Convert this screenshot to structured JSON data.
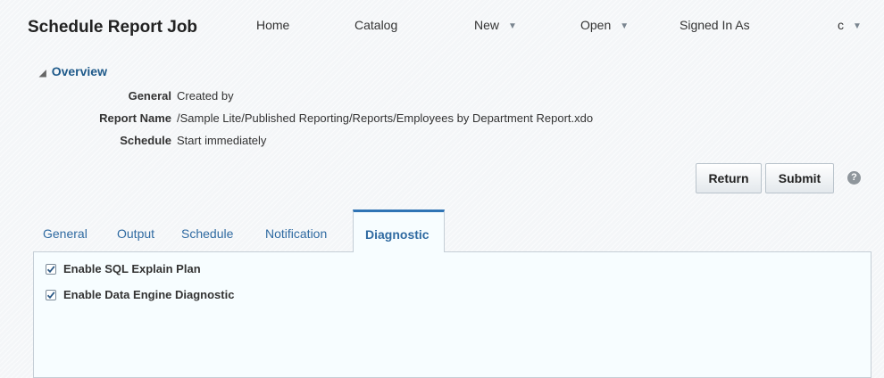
{
  "header": {
    "title": "Schedule Report Job",
    "nav": {
      "home": "Home",
      "catalog": "Catalog",
      "new": "New",
      "open": "Open",
      "signed_in_as": "Signed In As",
      "user": "c"
    }
  },
  "overview": {
    "toggle_label": "Overview",
    "rows": [
      {
        "label": "General",
        "value": "Created by"
      },
      {
        "label": "Report Name",
        "value": "/Sample Lite/Published Reporting/Reports/Employees by Department Report.xdo"
      },
      {
        "label": "Schedule",
        "value": "Start immediately"
      }
    ]
  },
  "actions": {
    "return_label": "Return",
    "submit_label": "Submit",
    "help_glyph": "?"
  },
  "tabs": {
    "items": [
      "General",
      "Output",
      "Schedule",
      "Notification",
      "Diagnostic"
    ],
    "active": "Diagnostic"
  },
  "diagnostic": {
    "options": [
      {
        "label": "Enable SQL Explain Plan",
        "checked": true
      },
      {
        "label": "Enable Data Engine Diagnostic",
        "checked": true
      }
    ]
  },
  "colors": {
    "link_blue": "#2f6aa1",
    "active_tab_border": "#2f74b5",
    "panel_bg": "#f7fdff"
  }
}
